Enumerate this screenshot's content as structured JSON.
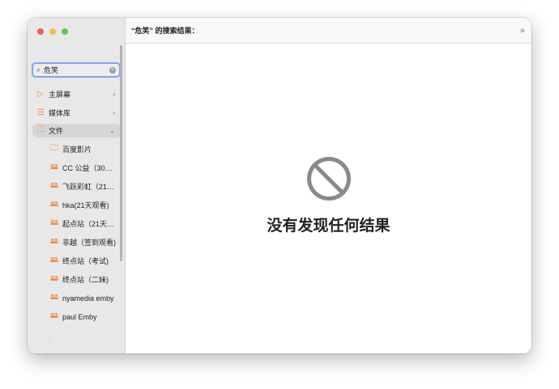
{
  "window": {
    "traffic_lights": {
      "close": "#ec5f57",
      "minimize": "#f4bd4f",
      "zoom": "#61c554"
    }
  },
  "search": {
    "value": "危笑",
    "clear_icon": "clear-icon"
  },
  "sidebar": {
    "top_items": [
      {
        "label": "主屏幕",
        "icon": "play-icon"
      },
      {
        "label": "媒体库",
        "icon": "library-icon"
      },
      {
        "label": "文件",
        "icon": "folder-icon"
      }
    ],
    "sub_items": [
      {
        "label": "百度影片",
        "icon": "folder-icon"
      },
      {
        "label": "CC 公益（30…",
        "icon": "server-icon"
      },
      {
        "label": "飞跃彩虹（21…",
        "icon": "server-icon"
      },
      {
        "label": "hka(21天观看)",
        "icon": "server-icon"
      },
      {
        "label": "起点站（21天…",
        "icon": "server-icon"
      },
      {
        "label": "非越（签到观看)",
        "icon": "server-icon"
      },
      {
        "label": "终点站（考试)",
        "icon": "server-icon"
      },
      {
        "label": "终点站（二妹)",
        "icon": "server-icon"
      },
      {
        "label": "nyamedia emby",
        "icon": "server-icon"
      },
      {
        "label": "paul Emby",
        "icon": "server-icon"
      }
    ]
  },
  "header": {
    "title": "“危笑” 的搜索结果：",
    "more": "»"
  },
  "main": {
    "empty_message": "没有发现任何结果"
  },
  "accent": "#f0883a"
}
